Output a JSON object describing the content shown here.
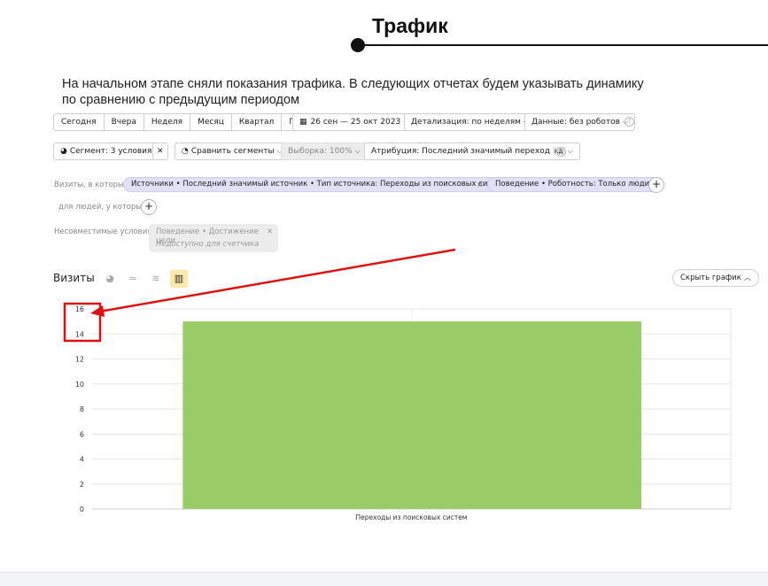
{
  "header": {
    "title": "Трафик",
    "intro": "На начальном этапе сняли показания трафика. В следующих отчетах будем указывать динамику по сравнению с предыдущим периодом"
  },
  "toolbar": {
    "periods": [
      "Сегодня",
      "Вчера",
      "Неделя",
      "Месяц",
      "Квартал",
      "Год"
    ],
    "date_range": "26 сен — 25 окт 2023",
    "detalization": "Детализация: по неделям",
    "data_mode": "Данные: без роботов",
    "segment": "Сегмент: 3 условия",
    "compare": "Сравнить сегменты",
    "sample": "Выборка: 100%",
    "attribution": "Атрибуция: Последний значимый переход",
    "attribution_badge": "кд"
  },
  "filters": {
    "visits_label": "Визиты, в которых",
    "chip_source": "Источники • Последний значимый источник • Тип источника: Переходы из поисковых систем",
    "and_label": "и",
    "chip_behavior": "Поведение • Роботность: Только люди",
    "people_label": "для людей, у которых",
    "incompatible_label": "Несовместимые условия:",
    "incompatible_item": "Поведение • Достижение цели",
    "incompatible_note": "Недоступно для счетчика"
  },
  "chart_section": {
    "title": "Визиты",
    "hide_chart": "Скрыть график"
  },
  "chart_data": {
    "type": "bar",
    "categories": [
      "Переходы из поисковых систем"
    ],
    "values": [
      15
    ],
    "ylim": [
      0,
      16
    ],
    "yticks": [
      0,
      2,
      4,
      6,
      8,
      10,
      12,
      14,
      16
    ],
    "bar_color": "#99cc66",
    "grid": true
  },
  "colors": {
    "annotation": "#e01010",
    "chip_bg": "#e2e0f7",
    "active_chart_type": "#fde9a8"
  }
}
